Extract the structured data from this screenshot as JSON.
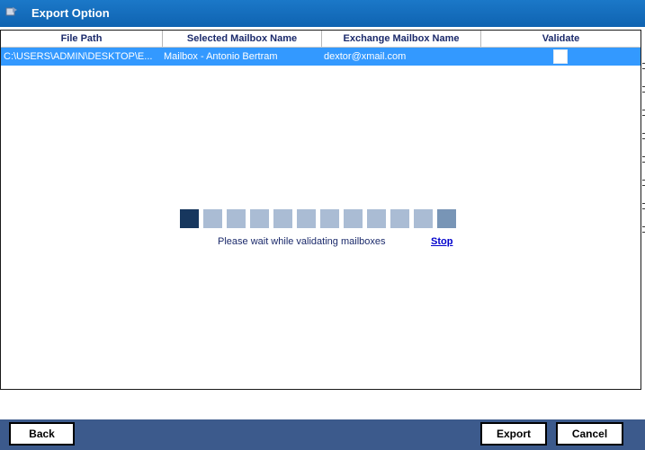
{
  "window": {
    "title": "Export Option",
    "icon": "export-app-icon"
  },
  "grid": {
    "columns": [
      "File Path",
      "Selected Mailbox Name",
      "Exchange Mailbox Name",
      "Validate"
    ],
    "rows": [
      {
        "file_path": "C:\\USERS\\ADMIN\\DESKTOP\\E...",
        "selected_mailbox": "Mailbox - Antonio Bertram",
        "exchange_mailbox": "dextor@xmail.com",
        "validate": false
      }
    ]
  },
  "progress": {
    "message": "Please wait while validating mailboxes",
    "stop_label": "Stop",
    "segments_total": 12,
    "active_segment": 1
  },
  "footer": {
    "back_label": "Back",
    "export_label": "Export",
    "cancel_label": "Cancel"
  },
  "colors": {
    "titlebar": "#0f63b1",
    "selected_row": "#3399ff",
    "footer": "#3c5a8c",
    "progress_active": "#17375e",
    "progress_idle": "#aabcd4"
  }
}
